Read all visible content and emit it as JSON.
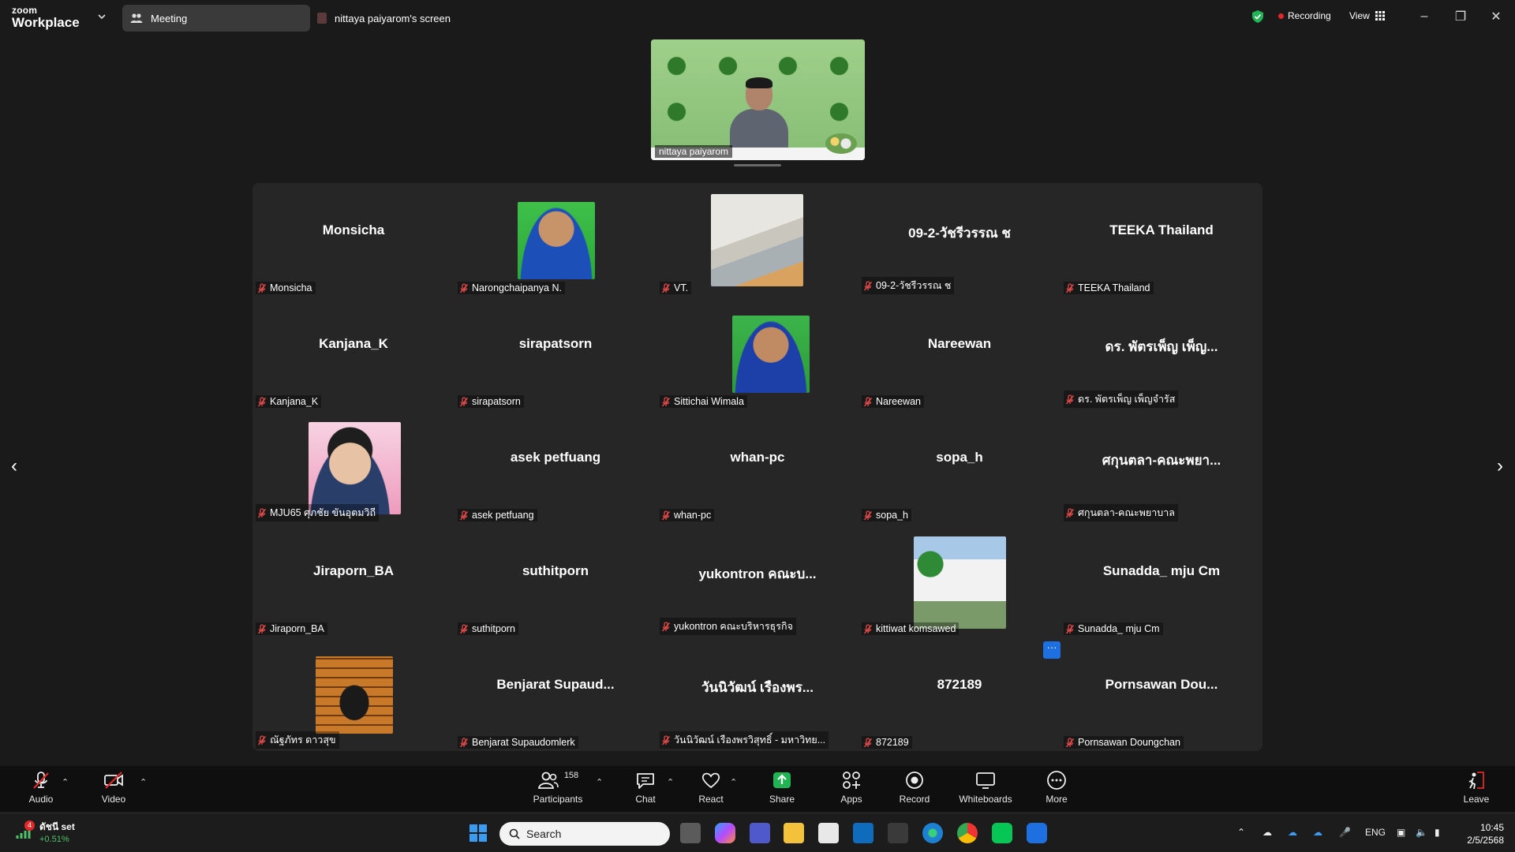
{
  "titlebar": {
    "brand_small": "zoom",
    "brand_large": "Workplace",
    "tab_meeting": "Meeting",
    "tab_screen": "nittaya paiyarom's screen",
    "recording": "Recording",
    "view": "View"
  },
  "speaker": {
    "name": "nittaya paiyarom"
  },
  "gallery": {
    "tiles": [
      {
        "display": "Monsicha",
        "label": "Monsicha"
      },
      {
        "display": "",
        "label": "Narongchaipanya N."
      },
      {
        "display": "",
        "label": "VT."
      },
      {
        "display": "09-2-วัชรีวรรณ ช",
        "label": "09-2-วัชรีวรรณ ช"
      },
      {
        "display": "TEEKA Thailand",
        "label": "TEEKA Thailand"
      },
      {
        "display": "Kanjana_K",
        "label": "Kanjana_K"
      },
      {
        "display": "sirapatsorn",
        "label": "sirapatsorn"
      },
      {
        "display": "",
        "label": "Sittichai Wimala"
      },
      {
        "display": "Nareewan",
        "label": "Nareewan"
      },
      {
        "display": "ดร. พัตรเพ็ญ เพ็ญ...",
        "label": "ดร. พัตรเพ็ญ เพ็ญจำรัส"
      },
      {
        "display": "",
        "label": "MJU65 ศุภชัย ขันอุตมวิถี"
      },
      {
        "display": "asek petfuang",
        "label": "asek petfuang"
      },
      {
        "display": "whan-pc",
        "label": "whan-pc"
      },
      {
        "display": "sopa_h",
        "label": "sopa_h"
      },
      {
        "display": "ศกุนตลา-คณะพยา...",
        "label": "ศกุนตลา-คณะพยาบาล"
      },
      {
        "display": "Jiraporn_BA",
        "label": "Jiraporn_BA"
      },
      {
        "display": "suthitporn",
        "label": "suthitporn"
      },
      {
        "display": "yukontron คณะบ...",
        "label": "yukontron คณะบริหารธุรกิจ"
      },
      {
        "display": "",
        "label": "kittiwat komsawed"
      },
      {
        "display": "Sunadda_ mju Cm",
        "label": "Sunadda_ mju Cm"
      },
      {
        "display": "",
        "label": "ณัฐภัทร ดาวสุข"
      },
      {
        "display": "Benjarat Supaud...",
        "label": "Benjarat Supaudomlerk"
      },
      {
        "display": "วันนิวัฒน์ เรืองพร...",
        "label": "วันนิวัฒน์ เรืองพรวิสุทธิ์ - มหาวิทย..."
      },
      {
        "display": "872189",
        "label": "872189"
      },
      {
        "display": "Pornsawan Dou...",
        "label": "Pornsawan Doungchan"
      }
    ],
    "more_badge": "···"
  },
  "toolbar": {
    "audio": "Audio",
    "video": "Video",
    "participants": "Participants",
    "participants_count": "158",
    "chat": "Chat",
    "react": "React",
    "share": "Share",
    "apps": "Apps",
    "record": "Record",
    "whiteboards": "Whiteboards",
    "more": "More",
    "leave": "Leave"
  },
  "taskbar": {
    "stock_name": "ดัชนี set",
    "stock_change": "+0.51%",
    "stock_badge": "4",
    "search_placeholder": "Search",
    "lang": "ENG",
    "time": "10:45",
    "date": "2/5/2568"
  },
  "colors": {
    "accent_blue": "#1e6fe0",
    "share_green": "#20b454",
    "mute_red": "#e02828",
    "gallery_bg": "#262626",
    "app_bg": "#1a1a1a"
  }
}
